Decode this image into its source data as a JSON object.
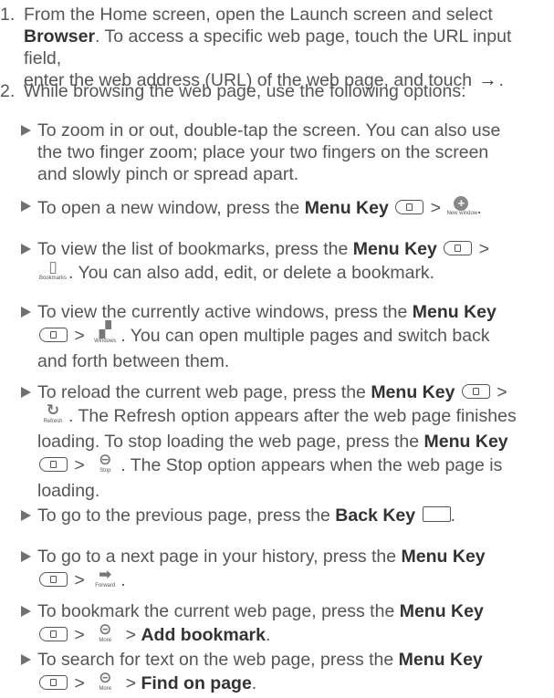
{
  "step1": {
    "number": "1.",
    "line1": "From the Home screen, open the Launch screen and select",
    "browser": "Browser",
    "line2_rest": ". To access a specific web page, touch the URL input field,",
    "line3": "enter the web address (URL) of the web page, and touch",
    "end": "."
  },
  "step2": {
    "number": "2.",
    "text": "While browsing the web page, use the following options:"
  },
  "bullets": {
    "zoom": {
      "line1": "To zoom in or out, double-tap the screen. You can also use",
      "line2": "the two finger zoom; place your two fingers on the screen",
      "line3": "and slowly pinch or spread apart."
    },
    "newwindow": {
      "pre": "To open a new window, press the",
      "menu_key": "Menu Key",
      "gt": ">",
      "icon_caption": "New window",
      "end": "."
    },
    "bookmarks": {
      "pre": "To view the list of bookmarks, press the",
      "menu_key": "Menu Key",
      "gt": ">",
      "icon_caption": "Bookmarks",
      "line2": ". You can also add, edit, or delete a bookmark."
    },
    "windows": {
      "pre": "To view the currently active windows, press the",
      "menu_key": "Menu Key",
      "gt": ">",
      "icon_caption": "Windows",
      "line2": ". You can open multiple pages and switch back",
      "line3": "and forth between them."
    },
    "reload": {
      "pre": "To reload the current web page, press the",
      "menu_key": "Menu Key",
      "gt": ">",
      "refresh_caption": "Refresh",
      "line2": ". The Refresh option appears after the web page finishes",
      "line3": "loading. To stop loading the web page, press the",
      "menu_key2": "Menu Key",
      "gt2": ">",
      "stop_caption": "Stop",
      "line4": ". The Stop option appears when the web page is",
      "line5": "loading."
    },
    "back": {
      "pre": "To go to the previous page, press the",
      "back_key": "Back Key",
      "end": "."
    },
    "forward": {
      "pre": "To go to a next page in your history, press the",
      "menu_key": "Menu Key",
      "gt": ">",
      "icon_caption": "Forward",
      "end": "."
    },
    "addbookmark": {
      "pre": "To bookmark the current web page, press the",
      "menu_key": "Menu Key",
      "gt": ">",
      "icon_caption": "More",
      "gt2": ">",
      "action": "Add bookmark",
      "end": "."
    },
    "find": {
      "pre": "To search for text on the web page, press the",
      "menu_key": "Menu Key",
      "gt": ">",
      "icon_caption": "More",
      "gt2": ">",
      "action": "Find on page",
      "end": "."
    }
  }
}
